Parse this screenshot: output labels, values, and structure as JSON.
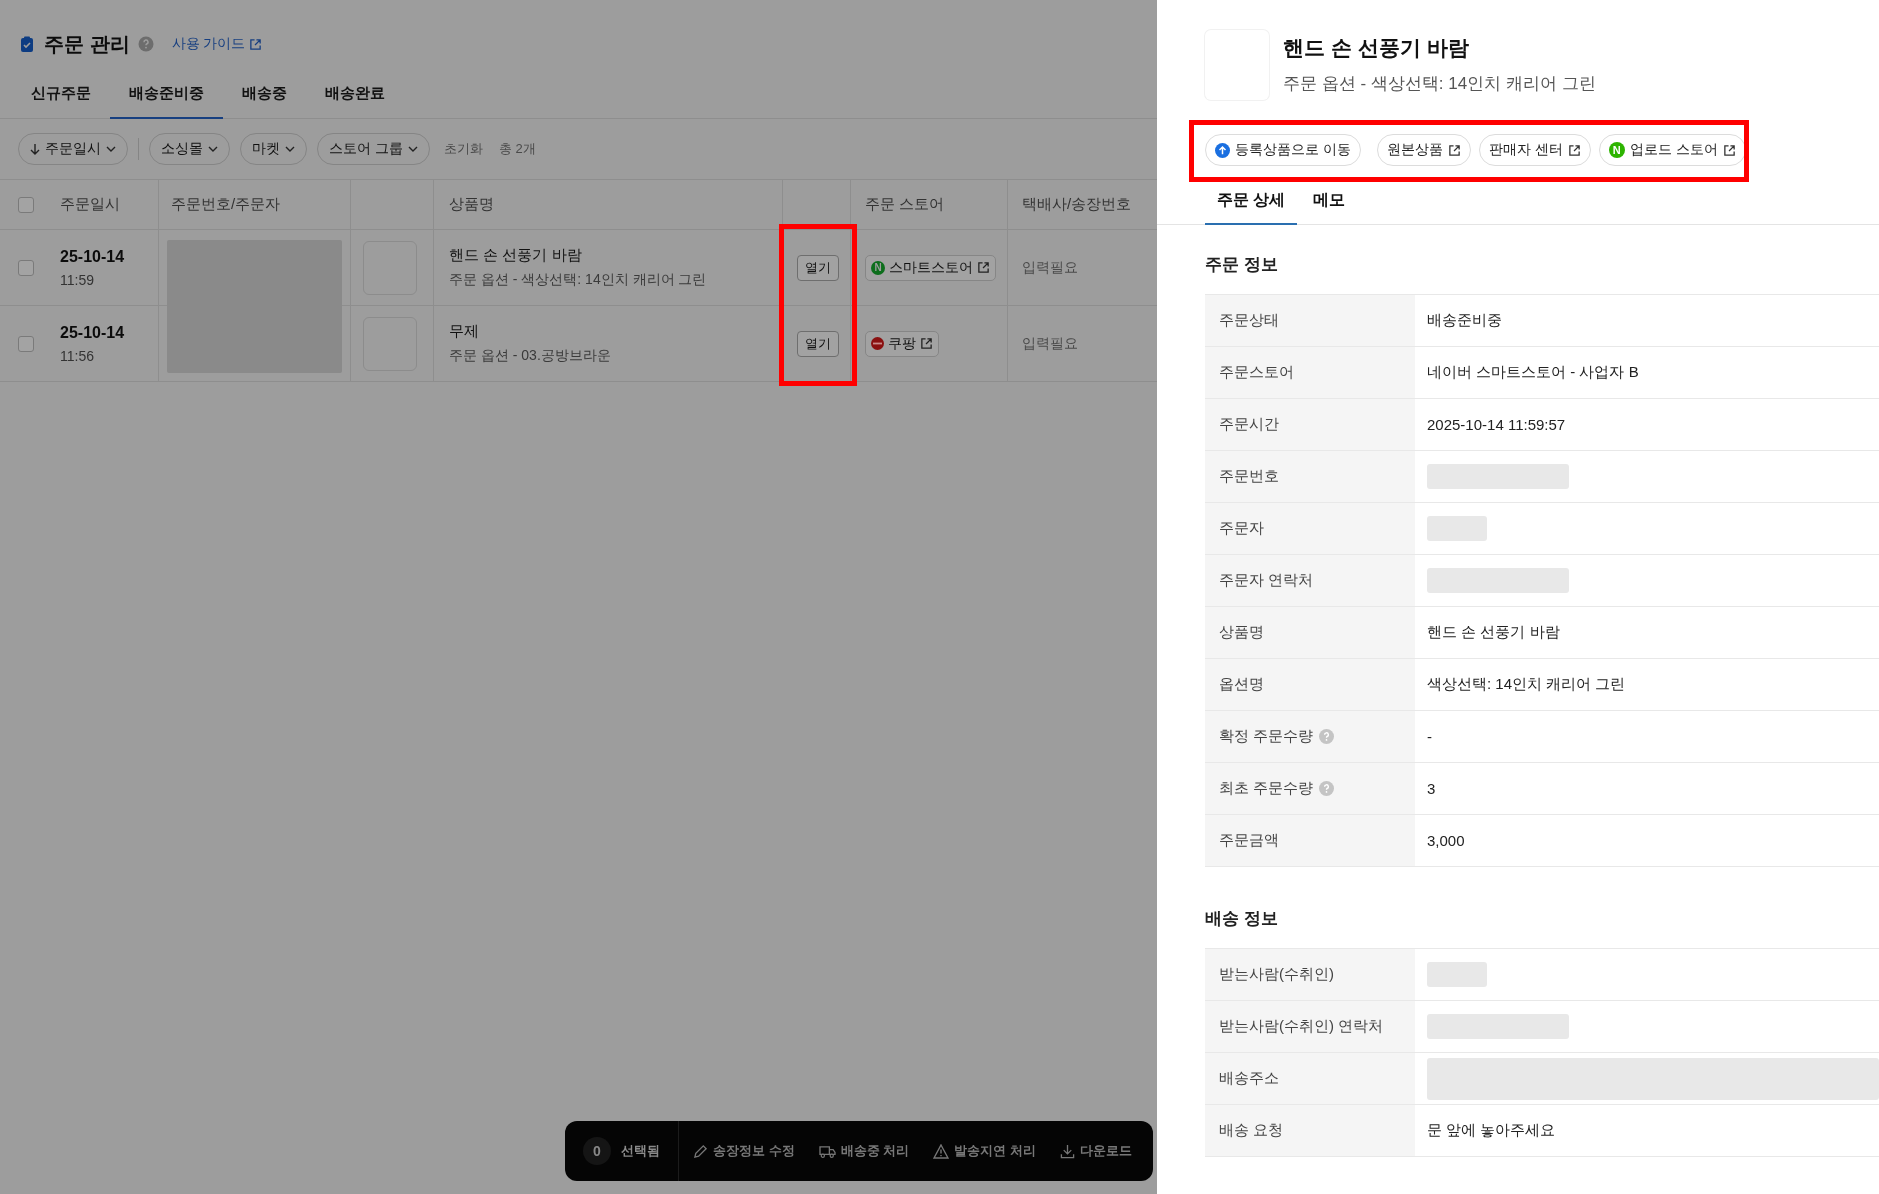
{
  "page": {
    "title": "주문 관리",
    "guide_link": "사용 가이드"
  },
  "tabs": [
    {
      "label": "신규주문",
      "selected": false
    },
    {
      "label": "배송준비중",
      "selected": true
    },
    {
      "label": "배송중",
      "selected": false
    },
    {
      "label": "배송완료",
      "selected": false
    }
  ],
  "filters": [
    {
      "label": "주문일시",
      "kind": "sort"
    },
    {
      "label": "소싱몰",
      "kind": "dropdown"
    },
    {
      "label": "마켓",
      "kind": "dropdown"
    },
    {
      "label": "스토어 그룹",
      "kind": "dropdown"
    }
  ],
  "reset": "초기화",
  "total": "총 2개",
  "table": {
    "all_checked": false,
    "columns": {
      "date": "주문일시",
      "order_no": "주문번호/주문자",
      "product": "상품명",
      "store": "주문 스토어",
      "courier": "택배사/송장번호"
    },
    "rows": [
      {
        "checked": false,
        "date": "25-10-14",
        "time": "11:59",
        "product": "핸드 손 선풍기 바람",
        "option": "주문 옵션 - 색상선택: 14인치 캐리어 그린",
        "open": "열기",
        "store": "스마트스토어",
        "kind": "naver",
        "store_badge": "N",
        "courier": "입력필요"
      },
      {
        "checked": false,
        "date": "25-10-14",
        "time": "11:56",
        "product": "무제",
        "option": "주문 옵션 - 03.공방브라운",
        "open": "열기",
        "store": "쿠팡",
        "kind": "coupang",
        "courier": "입력필요"
      }
    ]
  },
  "bottom_bar": {
    "count": "0",
    "count_label": "선택됨",
    "actions": [
      {
        "label": "송장정보 수정",
        "kind": "edit"
      },
      {
        "label": "배송중 처리",
        "kind": "truck"
      },
      {
        "label": "발송지연 처리",
        "kind": "warning"
      },
      {
        "label": "다운로드",
        "kind": "download"
      }
    ]
  },
  "detail": {
    "title": "핸드 손 선풍기 바람",
    "subtitle": "주문 옵션 - 색상선택: 14인치 캐리어 그린",
    "actions": [
      {
        "label": "등록상품으로 이동",
        "kind": "move"
      },
      {
        "label": "원본상품",
        "kind": "external"
      },
      {
        "label": "판매자 센터",
        "kind": "external"
      },
      {
        "label": "업로드 스토어",
        "kind": "store",
        "badge": "N"
      }
    ],
    "tabs": [
      {
        "label": "주문 상세",
        "selected": true
      },
      {
        "label": "메모",
        "selected": false
      }
    ],
    "sections": [
      {
        "title": "주문 정보",
        "rows": [
          {
            "label": "주문상태",
            "value": "배송준비중"
          },
          {
            "label": "주문스토어",
            "value": "네이버 스마트스토어 - 사업자 B"
          },
          {
            "label": "주문시간",
            "value": "2025-10-14 11:59:57"
          },
          {
            "label": "주문번호",
            "kind": "medium"
          },
          {
            "label": "주문자",
            "kind": "short"
          },
          {
            "label": "주문자 연락처",
            "kind": "medium"
          },
          {
            "label": "상품명",
            "value": "핸드 손 선풍기 바람"
          },
          {
            "label": "옵션명",
            "value": "색상선택: 14인치 캐리어 그린"
          },
          {
            "label": "확정 주문수량",
            "help": true,
            "value": "-"
          },
          {
            "label": "최초 주문수량",
            "help": true,
            "value": "3"
          },
          {
            "label": "주문금액",
            "value": "3,000"
          }
        ]
      },
      {
        "title": "배송 정보",
        "rows": [
          {
            "label": "받는사람(수취인)",
            "kind": "short"
          },
          {
            "label": "받는사람(수취인) 연락처",
            "kind": "medium"
          },
          {
            "label": "배송주소",
            "kind": "wide"
          },
          {
            "label": "배송 요청",
            "value": "문 앞에 놓아주세요"
          }
        ]
      }
    ]
  }
}
